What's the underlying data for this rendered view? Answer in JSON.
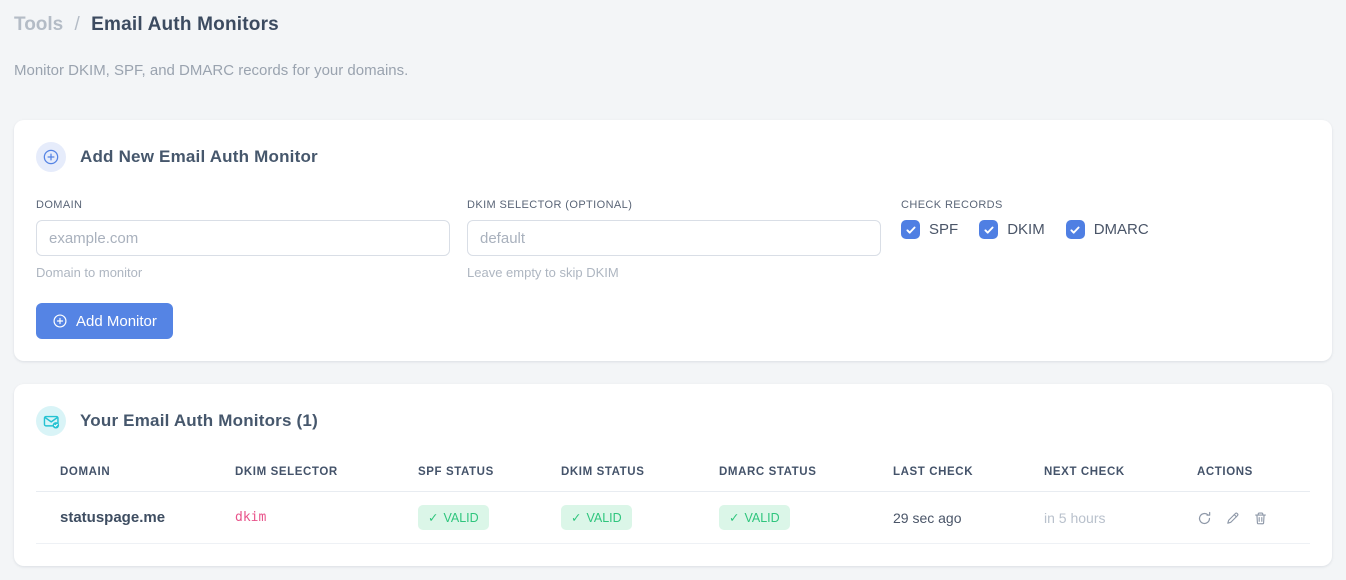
{
  "breadcrumb": {
    "section": "Tools",
    "separator": "/",
    "current": "Email Auth Monitors"
  },
  "subtitle": "Monitor DKIM, SPF, and DMARC records for your domains.",
  "add_card": {
    "title": "Add New Email Auth Monitor",
    "domain_field": {
      "label": "DOMAIN",
      "placeholder": "example.com",
      "value": "",
      "helper": "Domain to monitor"
    },
    "dkim_field": {
      "label": "DKIM SELECTOR (OPTIONAL)",
      "placeholder": "default",
      "value": "",
      "helper": "Leave empty to skip DKIM"
    },
    "check_records": {
      "label": "CHECK RECORDS",
      "options": [
        {
          "label": "SPF",
          "checked": true
        },
        {
          "label": "DKIM",
          "checked": true
        },
        {
          "label": "DMARC",
          "checked": true
        }
      ]
    },
    "submit_label": "Add Monitor"
  },
  "monitors_card": {
    "title": "Your Email Auth Monitors (1)",
    "table": {
      "headers": [
        "DOMAIN",
        "DKIM SELECTOR",
        "SPF STATUS",
        "DKIM STATUS",
        "DMARC STATUS",
        "LAST CHECK",
        "NEXT CHECK",
        "ACTIONS"
      ],
      "rows": [
        {
          "domain": "statuspage.me",
          "dkim_selector": "dkim",
          "spf_status": "VALID",
          "dkim_status": "VALID",
          "dmarc_status": "VALID",
          "last_check": "29 sec ago",
          "next_check": "in 5 hours"
        }
      ]
    }
  },
  "icons": {
    "check": "✓"
  },
  "colors": {
    "accent_blue": "#5584e4",
    "badge_green_text": "#2fc57d",
    "badge_green_bg": "#dbf6e8",
    "code_pink": "#e8538a",
    "teal": "#25c2d2",
    "page_bg": "#f3f5f7"
  }
}
